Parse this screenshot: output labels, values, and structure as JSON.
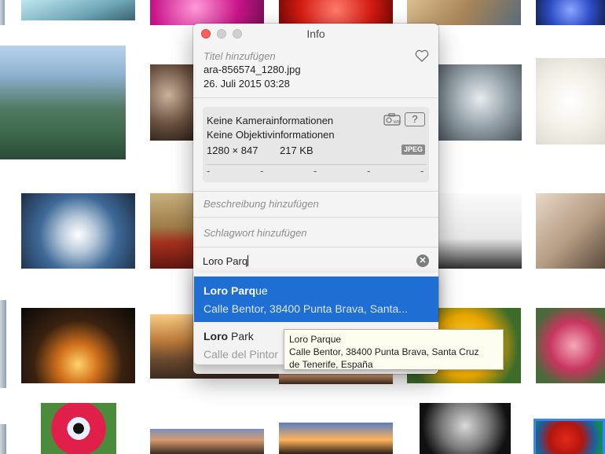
{
  "window": {
    "title": "Info"
  },
  "info": {
    "title_placeholder": "Titel hinzufügen",
    "file_name": "ara-856574_1280.jpg",
    "date_time": "26. Juli 2015   03:28",
    "camera_info": "Keine Kamerainformationen",
    "lens_info": "Keine Objektivinformationen",
    "dimensions": "1280 × 847",
    "file_size": "217 KB",
    "format_badge": "JPEG",
    "exif_placeholders": [
      "-",
      "-",
      "-",
      "-",
      "-"
    ],
    "description_placeholder": "Beschreibung hinzufügen",
    "keyword_placeholder": "Schlagwort hinzufügen",
    "location_value": "Loro Parq"
  },
  "suggestions": [
    {
      "name_match": "Loro Parq",
      "name_rest": "ue",
      "address": "Calle Bentor, 38400 Punta Brava, Santa..."
    },
    {
      "name_match": "Loro",
      "name_rest": " Park",
      "address": "Calle del Pintor"
    }
  ],
  "tooltip": {
    "line1": "Loro Parque",
    "line2": "Calle Bentor, 38400 Punta Brava, Santa Cruz",
    "line3": "de Tenerife, España"
  },
  "icons": {
    "favorite": "heart-icon",
    "camera": "camera-wb-icon",
    "unknown": "question-icon",
    "clear": "clear-icon"
  },
  "colors": {
    "selection": "#1f6ed4",
    "close": "#fc605c"
  }
}
